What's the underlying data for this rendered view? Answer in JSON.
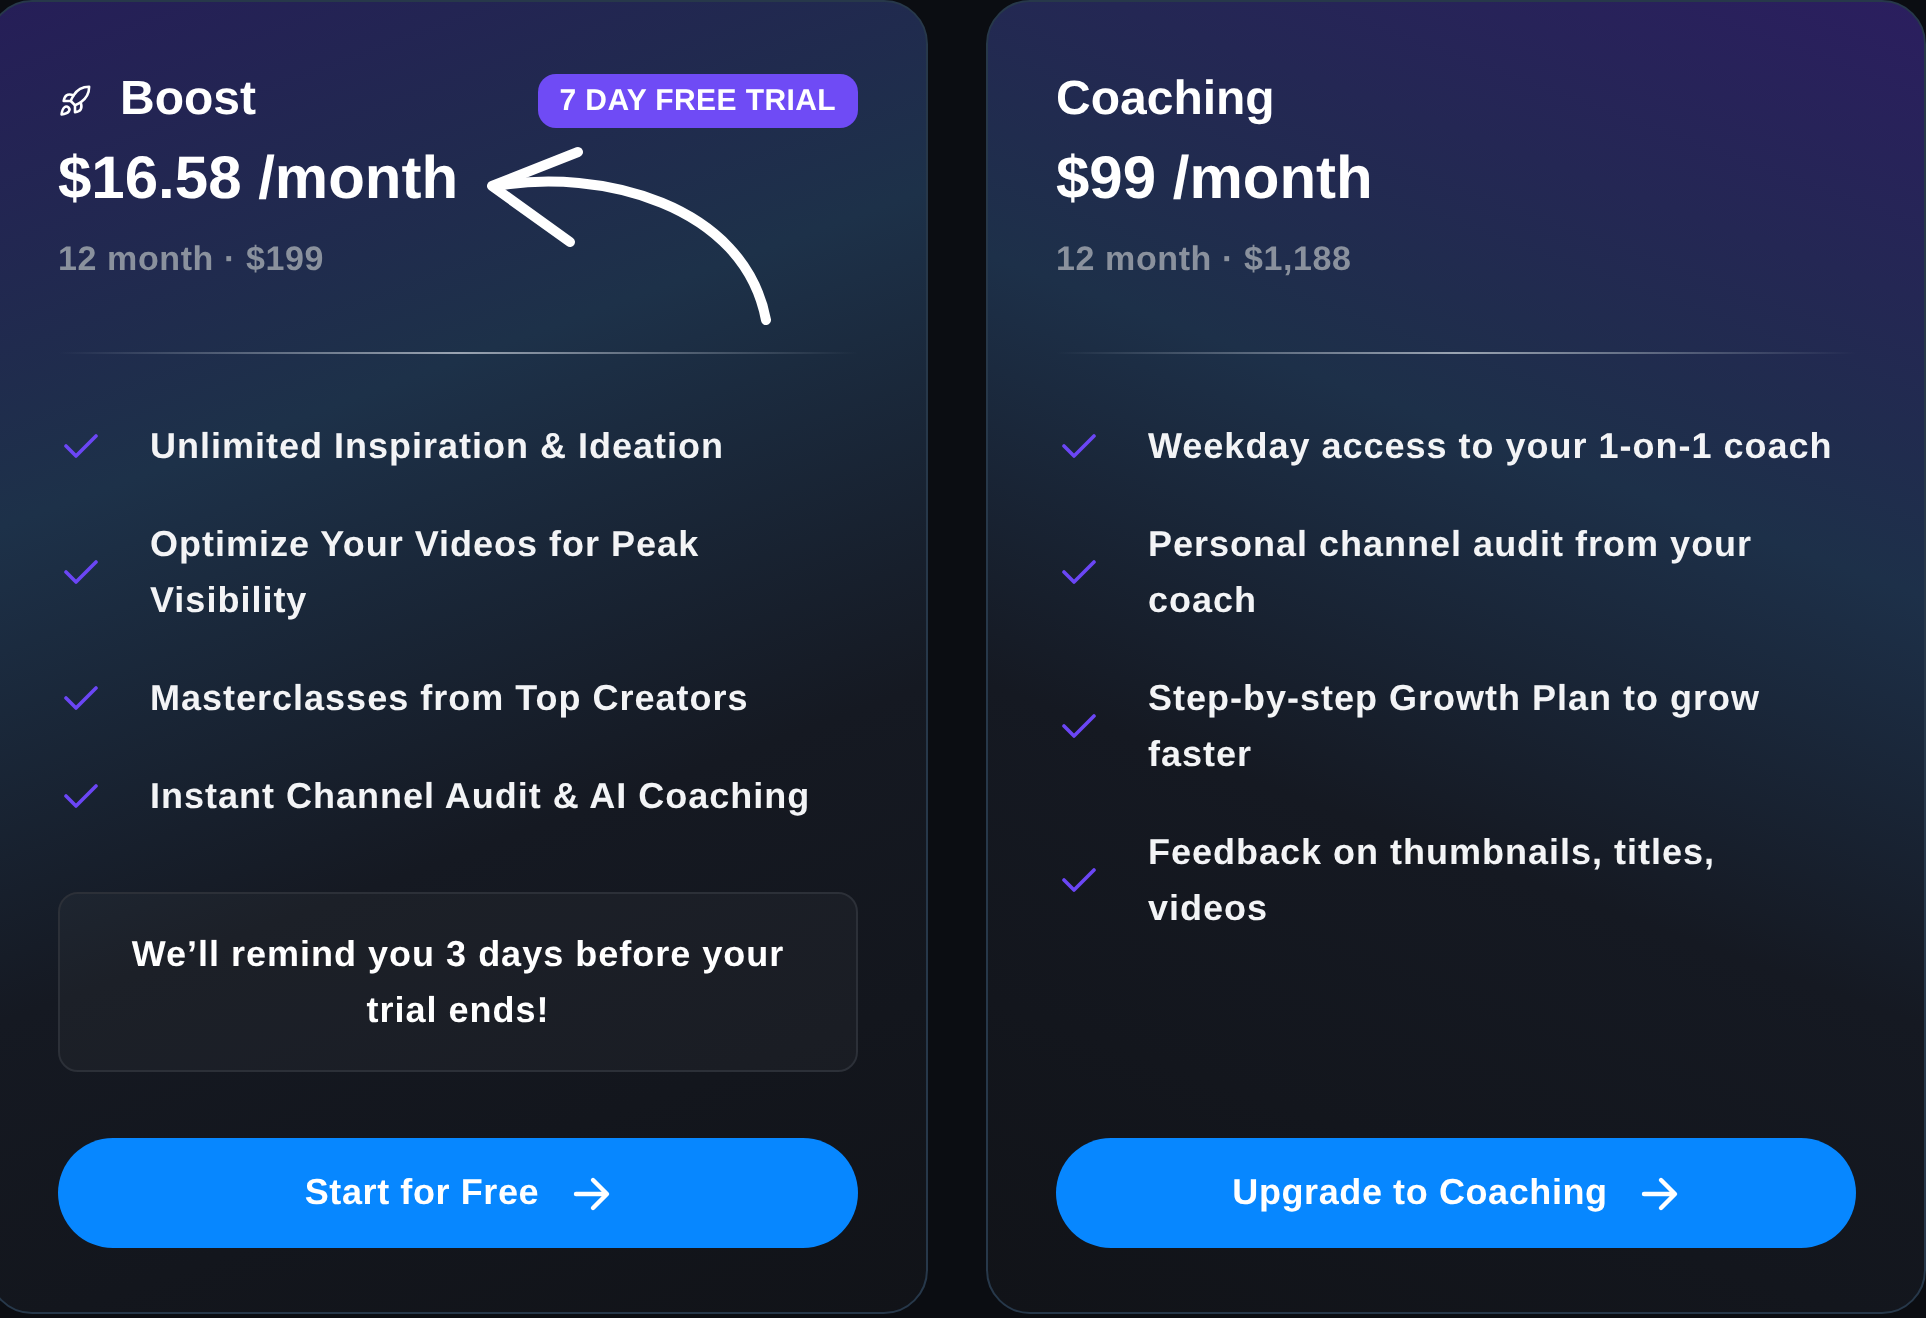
{
  "plans": [
    {
      "kind": "featured",
      "name": "Boost",
      "badge": "7 DAY FREE TRIAL",
      "price": "$16.58 /month",
      "billing": "12 month · $199",
      "features": [
        "Unlimited Inspiration & Ideation",
        "Optimize Your Videos for Peak Visibility",
        "Masterclasses from Top Creators",
        "Instant Channel Audit & AI Coaching"
      ],
      "note": "We’ll remind you 3 days before your trial ends!",
      "button": "Start for Free"
    },
    {
      "kind": "standard",
      "name": "Coaching",
      "price": "$99 /month",
      "billing": "12 month · $1,188",
      "features": [
        "Weekday access to your 1-on-1 coach",
        "Personal channel audit from your coach",
        "Step-by-step Growth Plan to grow faster",
        "Feedback on thumbnails, titles, videos"
      ],
      "button": "Upgrade to Coaching"
    }
  ]
}
